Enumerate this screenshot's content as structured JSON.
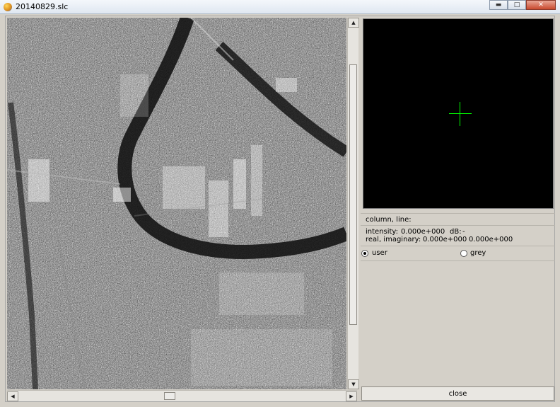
{
  "window": {
    "title": "20140829.slc",
    "minimize_glyph": "▬",
    "maximize_glyph": "□",
    "close_glyph": "✕"
  },
  "scrollbars": {
    "up_glyph": "▲",
    "down_glyph": "▼",
    "left_glyph": "◀",
    "right_glyph": "▶"
  },
  "info": {
    "position_label": "column, line:",
    "intensity_label": "intensity:",
    "intensity_value": "0.000e+000",
    "db_label": "dB:",
    "db_value": "-",
    "complex_label": "real, imaginary:",
    "real_value": "0.000e+000",
    "imaginary_value": "0.000e+000"
  },
  "colormap": {
    "options": [
      {
        "label": "user",
        "selected": true
      },
      {
        "label": "grey",
        "selected": false
      }
    ]
  },
  "close_button": {
    "label": "close"
  },
  "colors": {
    "crosshair": "#00ff00",
    "preview_bg": "#000000"
  }
}
